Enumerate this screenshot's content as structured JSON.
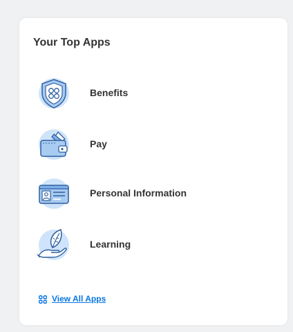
{
  "card": {
    "title": "Your Top Apps",
    "apps": [
      {
        "label": "Benefits",
        "icon": "shield-icon"
      },
      {
        "label": "Pay",
        "icon": "wallet-icon"
      },
      {
        "label": "Personal Information",
        "icon": "id-card-icon"
      },
      {
        "label": "Learning",
        "icon": "leaf-hand-icon"
      }
    ],
    "view_all_label": "View All Apps",
    "view_all_icon": "grid-icon"
  },
  "colors": {
    "accent": "#0875e1",
    "icon_bg": "#cfe4fb",
    "icon_fill": "#a8cbf2",
    "icon_stroke": "#2e5f9e",
    "card_bg": "#ffffff",
    "page_bg": "#f0f1f2",
    "text": "#333333"
  }
}
